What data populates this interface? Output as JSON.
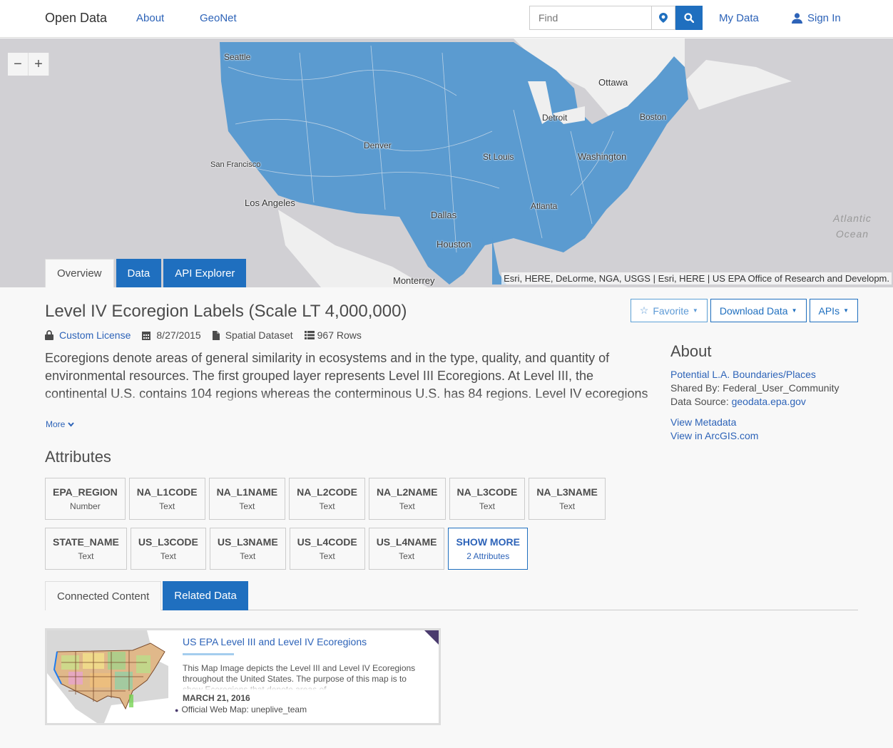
{
  "header": {
    "brand": "Open Data",
    "nav": [
      "About",
      "GeoNet"
    ],
    "search_placeholder": "Find",
    "my_data": "My Data",
    "sign_in": "Sign In"
  },
  "map": {
    "zoom_out": "−",
    "zoom_in": "+",
    "cities": [
      "Seattle",
      "Ottawa",
      "Detroit",
      "Boston",
      "Denver",
      "St Louis",
      "Washington",
      "San Francisco",
      "Los Angeles",
      "Atlanta",
      "Dallas",
      "Houston",
      "Monterrey"
    ],
    "ocean_label": [
      "Atlantic",
      "Ocean"
    ],
    "attribution": "Esri, HERE, DeLorme, NGA, USGS | Esri, HERE | US EPA Office of Research and Developm.",
    "tabs": [
      "Overview",
      "Data",
      "API Explorer"
    ],
    "region_color": "#5b9bd0",
    "background_color": "#d1d0d4"
  },
  "dataset": {
    "title": "Level IV Ecoregion Labels (Scale LT 4,000,000)",
    "license": "Custom License",
    "date": "8/27/2015",
    "type": "Spatial Dataset",
    "rows": "967 Rows",
    "description": "Ecoregions denote areas of general similarity in ecosystems and in the type, quality, and quantity of environmental resources. The first grouped layer represents Level III Ecoregions. At Level III, the continental U.S. contains 104 regions whereas the conterminous U.S. has 84 regions. Level IV ecoregions are further subdivisions of Level III ecoregions. The grouped layer represents Level IV ecoregions.",
    "more_label": "More"
  },
  "actions": {
    "favorite": "Favorite",
    "download": "Download Data",
    "apis": "APIs"
  },
  "about": {
    "heading": "About",
    "category": "Potential L.A. Boundaries/Places",
    "shared_by_label": "Shared By:",
    "shared_by": "Federal_User_Community",
    "source_label": "Data Source:",
    "source": "geodata.epa.gov",
    "view_metadata": "View Metadata",
    "view_arcgis": "View in ArcGIS.com"
  },
  "attributes": {
    "heading": "Attributes",
    "rows": [
      [
        {
          "name": "EPA_REGION",
          "type": "Number"
        },
        {
          "name": "NA_L1CODE",
          "type": "Text"
        },
        {
          "name": "NA_L1NAME",
          "type": "Text"
        },
        {
          "name": "NA_L2CODE",
          "type": "Text"
        },
        {
          "name": "NA_L2NAME",
          "type": "Text"
        },
        {
          "name": "NA_L3CODE",
          "type": "Text"
        },
        {
          "name": "NA_L3NAME",
          "type": "Text"
        }
      ],
      [
        {
          "name": "STATE_NAME",
          "type": "Text"
        },
        {
          "name": "US_L3CODE",
          "type": "Text"
        },
        {
          "name": "US_L3NAME",
          "type": "Text"
        },
        {
          "name": "US_L4CODE",
          "type": "Text"
        },
        {
          "name": "US_L4NAME",
          "type": "Text"
        }
      ]
    ],
    "show_more": "SHOW MORE",
    "show_more_count": "2 Attributes"
  },
  "lower_tabs": [
    "Connected Content",
    "Related Data"
  ],
  "related_card": {
    "title": "US EPA Level III and Level IV Ecoregions",
    "description": "This Map Image depicts the Level III and Level IV Ecoregions throughout the United States. The purpose of this map is to show Ecoregions that denote areas of",
    "date": "MARCH 21, 2016",
    "owner": "Official Web Map: uneplive_team"
  },
  "colors": {
    "accent": "#1f6fbf",
    "link": "#2d63b8"
  }
}
